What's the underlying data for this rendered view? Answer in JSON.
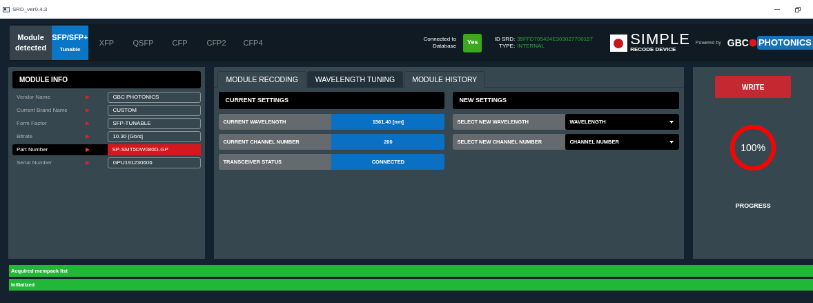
{
  "window": {
    "title": "SRD_ver0.4.3"
  },
  "module_status": "Module detected",
  "module_tabs": [
    {
      "label": "SFP/SFP+",
      "sublabel": "Tunable",
      "selected": true
    },
    {
      "label": "XFP",
      "selected": false
    },
    {
      "label": "QSFP",
      "selected": false
    },
    {
      "label": "CFP",
      "selected": false
    },
    {
      "label": "CFP2",
      "selected": false
    },
    {
      "label": "CFP4",
      "selected": false
    }
  ],
  "database": {
    "label": "Connected to Database",
    "value": "Yes"
  },
  "srd_info": {
    "id_label": "ID SRD:",
    "id": "35FFD705424E303027700157",
    "type_label": "TYPE:",
    "type": "INTERNAL"
  },
  "logo": {
    "title": "SIMPLE",
    "subtitle": "RECODE DEVICE"
  },
  "powered_by": "Powered by",
  "partner_logo": {
    "part_1": "GBC",
    "part_2": "PHOTONICS"
  },
  "module_info": {
    "title": "MODULE INFO",
    "rows": [
      {
        "label": "Vendor Name",
        "value": "GBC PHOTONICS",
        "selected": false
      },
      {
        "label": "Current Brand Name",
        "value": "CUSTOM",
        "selected": false
      },
      {
        "label": "Form Factor",
        "value": "SFP-TUNABLE",
        "selected": false
      },
      {
        "label": "Bitrate",
        "value": "10.30 [Gb/s]",
        "selected": false
      },
      {
        "label": "Part Number",
        "value": "SP-SMT5DW080D-GP",
        "selected": true
      },
      {
        "label": "Serial Number",
        "value": "GPU191230606",
        "selected": false
      }
    ]
  },
  "section_tabs": [
    {
      "label": "MODULE RECODING",
      "selected": false
    },
    {
      "label": "WAVELENGTH TUNING",
      "selected": true
    },
    {
      "label": "MODULE HISTORY",
      "selected": false
    }
  ],
  "current_settings": {
    "title": "CURRENT SETTINGS",
    "rows": [
      {
        "label": "CURRENT WAVELENGTH",
        "value": "1561.40 [nm]"
      },
      {
        "label": "CURRENT CHANNEL NUMBER",
        "value": "200"
      },
      {
        "label": "TRANSCEIVER STATUS",
        "value": "CONNECTED"
      }
    ]
  },
  "new_settings": {
    "title": "NEW SETTINGS",
    "rows": [
      {
        "label": "SELECT NEW WAVELENGTH",
        "value": "WAVELENGTH"
      },
      {
        "label": "SELECT NEW CHANNEL NUMBER",
        "value": "CHANNEL NUMBER"
      }
    ]
  },
  "write_button": "WRITE",
  "progress": {
    "level": 1,
    "reading": "100%",
    "label": "PROGRESS"
  },
  "status_log": [
    "Acquired mempack list",
    "Initialized"
  ]
}
